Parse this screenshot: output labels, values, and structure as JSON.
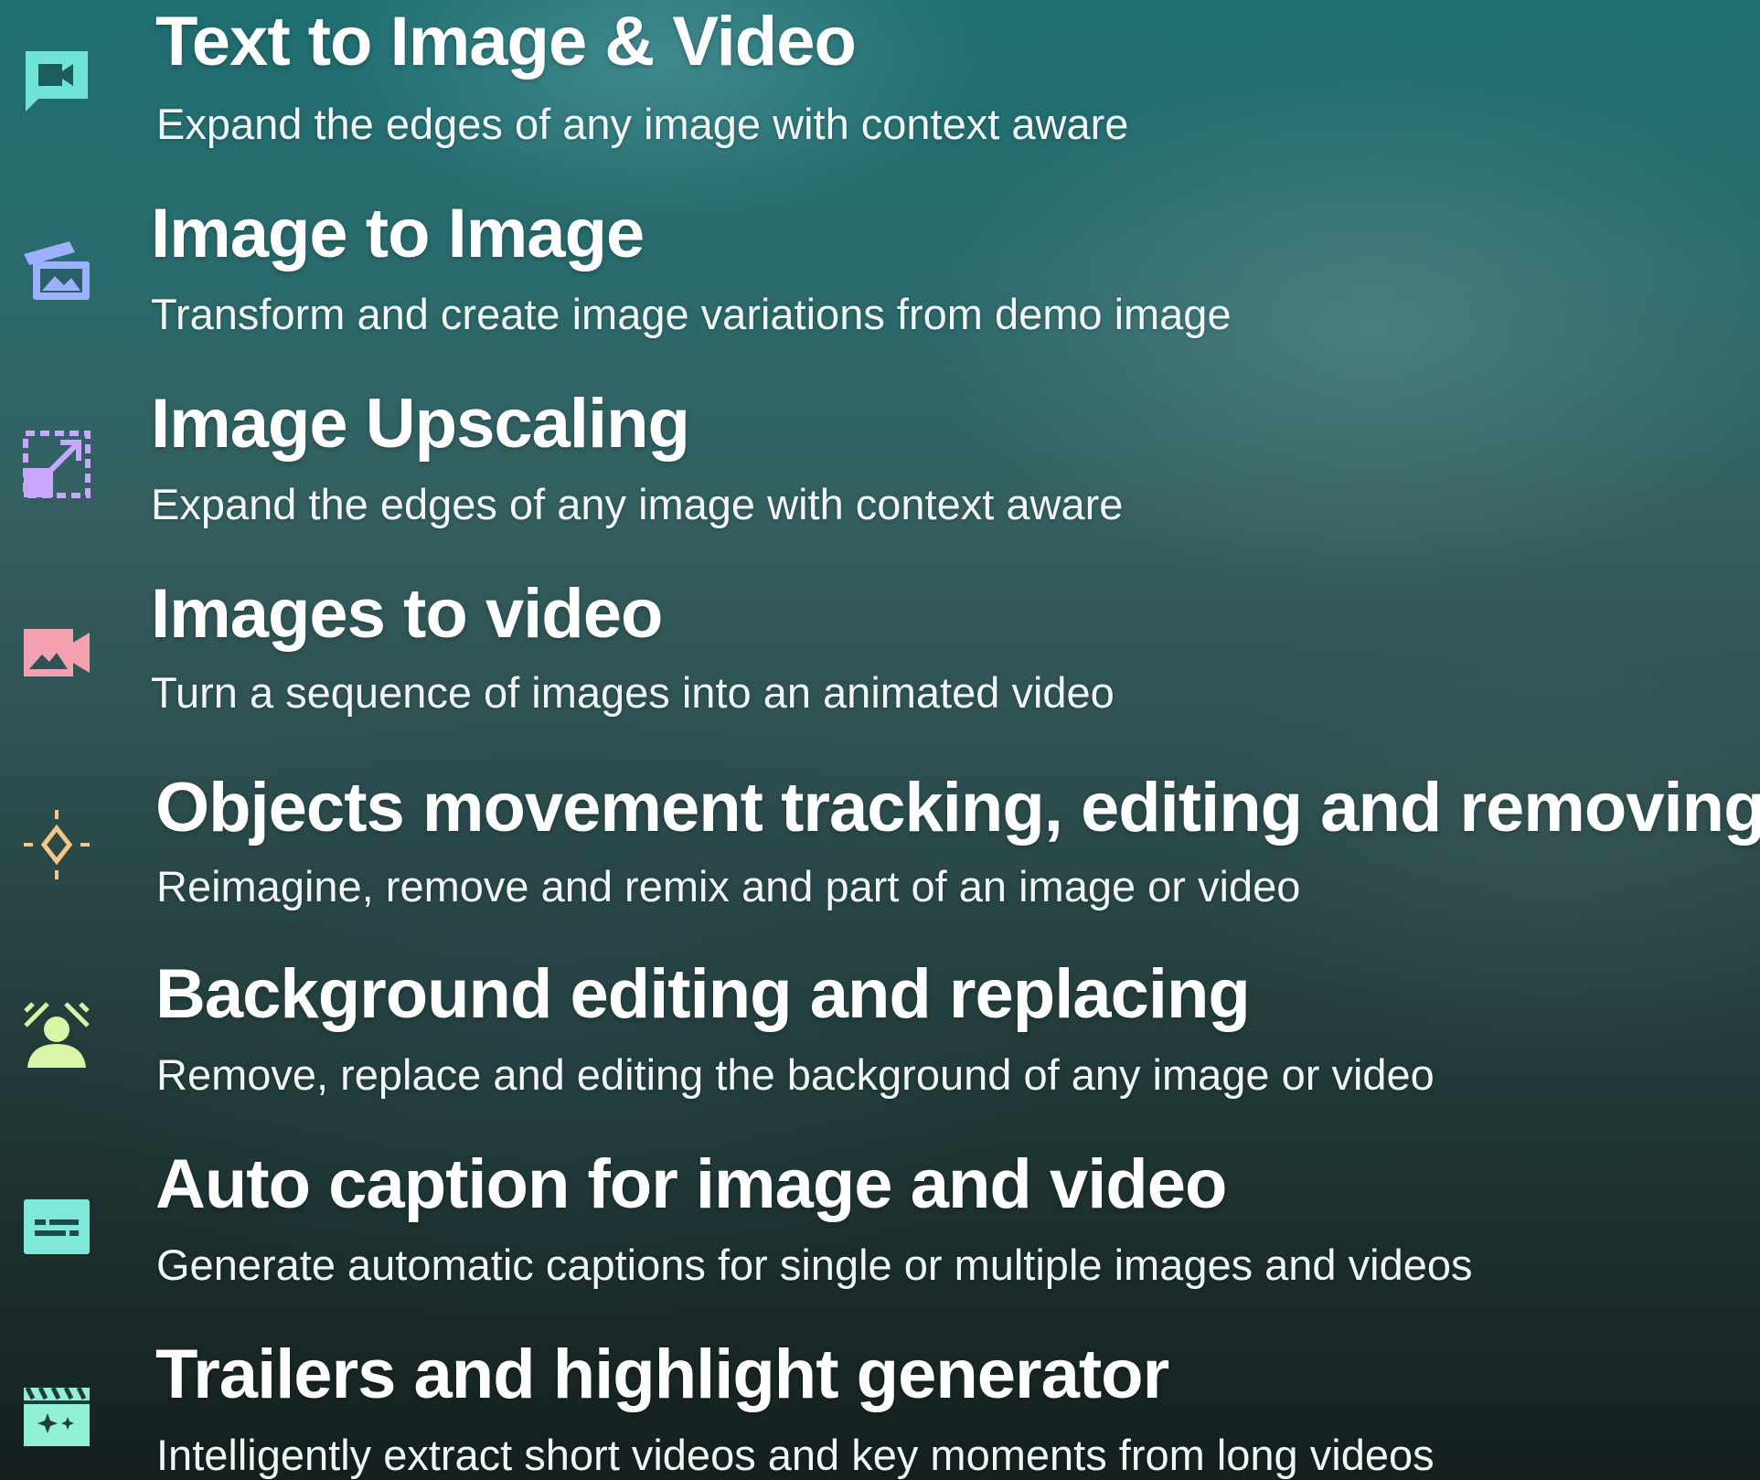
{
  "features": [
    {
      "title": "Text to Image & Video",
      "description": "Expand the edges of any image with context aware",
      "icon": "video-chat-icon",
      "color": "#6fe3d6"
    },
    {
      "title": "Image to Image",
      "description": "Transform and create image variations from demo image",
      "icon": "image-stack-icon",
      "color": "#9db0ff"
    },
    {
      "title": "Image Upscaling",
      "description": "Expand the edges of any image with context aware",
      "icon": "upscale-icon",
      "color": "#c9a6ff"
    },
    {
      "title": "Images to video",
      "description": "Turn a sequence of images into an animated video",
      "icon": "image-video-icon",
      "color": "#f3a0b0"
    },
    {
      "title": "Objects movement tracking, editing and removing",
      "description": "Reimagine, remove and remix and part of an image or video",
      "icon": "tracking-diamond-icon",
      "color": "#f5c88a"
    },
    {
      "title": "Background editing and replacing",
      "description": "Remove, replace and editing the background of any image or video",
      "icon": "person-background-icon",
      "color": "#d8f5a8"
    },
    {
      "title": "Auto caption for image and video",
      "description": "Generate automatic captions for single or multiple images and videos",
      "icon": "caption-icon",
      "color": "#7fe8d8"
    },
    {
      "title": "Trailers and highlight generator",
      "description": "Intelligently extract short videos and key moments from long videos",
      "icon": "clapperboard-sparkle-icon",
      "color": "#8ff0d4"
    }
  ]
}
